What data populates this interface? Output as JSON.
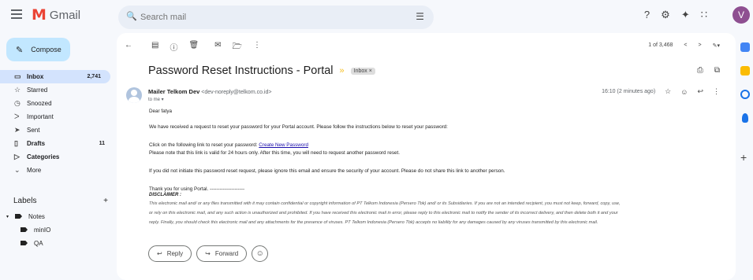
{
  "app": {
    "name": "Gmail",
    "logo_letter": "M"
  },
  "search": {
    "placeholder": "Search mail"
  },
  "user": {
    "avatar_initial": "V",
    "avatar_color": "#8e4f91"
  },
  "compose_label": "Compose",
  "nav": [
    {
      "label": "Inbox",
      "icon": "inbox-icon",
      "count": "2,741",
      "active": true
    },
    {
      "label": "Starred",
      "icon": "star-icon"
    },
    {
      "label": "Snoozed",
      "icon": "clock-icon"
    },
    {
      "label": "Important",
      "icon": "important-icon"
    },
    {
      "label": "Sent",
      "icon": "send-icon"
    },
    {
      "label": "Drafts",
      "icon": "draft-icon",
      "count": "11",
      "bold": true
    },
    {
      "label": "Categories",
      "icon": "label-icon",
      "bold": true
    },
    {
      "label": "More",
      "icon": "chevron-down-icon"
    }
  ],
  "labels": {
    "title": "Labels",
    "items": [
      "Notes",
      "minIO",
      "QA"
    ]
  },
  "pager": {
    "text": "1 of 3,468"
  },
  "email": {
    "subject": "Password Reset Instructions - Portal",
    "tag": "Inbox ×",
    "sender_name": "Mailer Telkom Dev",
    "sender_email": "<dev-noreply@telkom.co.id>",
    "to": "to me ▾",
    "time": "16:10 (2 minutes ago)",
    "greeting": "Dear fatya",
    "para1": "We have received a request to reset your password for your Portal account. Please follow the instructions below to reset your password:",
    "link_prefix": "Click on the following link to reset your password: ",
    "link_text": "Create New Password",
    "para2": "Please note that this link is valid for 24 hours only. After this time, you will need to request another password reset.",
    "para3": "If you did not initiate this password reset request, please ignore this email and ensure the security of your account. Please do not share this link to another person.",
    "thanks": "Thank you for using Portal. ---------------------",
    "disclaimer_head": "DISCLAIMER :",
    "disclaimer_1": "This electronic mail and/ or any files transmitted with it may contain confidential or copyright information of PT Telkom Indonesia (Persero Tbk) and/ or its Subsidiaries. If you are not an intended recipient, you must not keep, forward, copy, use,",
    "disclaimer_2": "or rely on this electronic mail, and any such action is unauthorized and prohibited. If you have received this electronic mail in error, please reply to this electronic mail to notify the sender of its incorrect delivery, and then delete both it and your",
    "disclaimer_3": "reply. Finally, you should check this electronic mail and any attachments for the presence of viruses. PT Telkom Indonesia (Persero Tbk) accepts no liability for any damages caused by any viruses transmitted by this electronic mail."
  },
  "actions": {
    "reply": "Reply",
    "forward": "Forward"
  }
}
